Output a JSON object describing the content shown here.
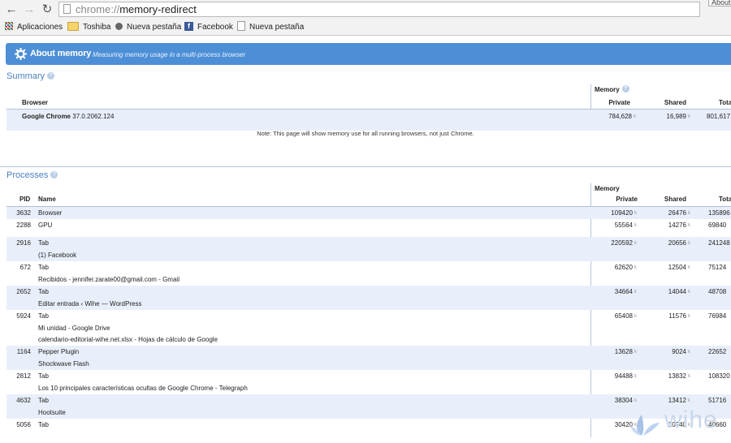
{
  "browser": {
    "url_scheme": "chrome://",
    "url_path": "memory-redirect",
    "about_tab": "About"
  },
  "bookmarks": [
    {
      "label": "Aplicaciones",
      "icon": "apps-icon"
    },
    {
      "label": "Toshiba",
      "icon": "folder-icon"
    },
    {
      "label": "Nueva pestaña",
      "icon": "circle-icon"
    },
    {
      "label": "Facebook",
      "icon": "facebook-icon"
    },
    {
      "label": "Nueva pestaña",
      "icon": "page-icon"
    }
  ],
  "header": {
    "title": "About memory",
    "subtitle": "Measuring memory usage in a multi-process browser"
  },
  "summary": {
    "title": "Summary",
    "col_browser": "Browser",
    "col_memory": "Memory",
    "col_private": "Private",
    "col_shared": "Shared",
    "col_total": "Total",
    "row": {
      "name": "Google Chrome",
      "version": "37.0.2062.124",
      "private": "784,628",
      "shared": "16,989",
      "total": "801,617"
    },
    "unit": "k",
    "note": "Note: This page will show memory use for all running browsers, not just Chrome."
  },
  "processes": {
    "title": "Processes",
    "col_pid": "PID",
    "col_name": "Name",
    "col_memory": "Memory",
    "col_private": "Private",
    "col_shared": "Shared",
    "col_total": "Total",
    "unit": "k",
    "rows": [
      {
        "pid": "3632",
        "type": "Browser",
        "lines": [],
        "private": "109420",
        "shared": "26476",
        "total": "135896"
      },
      {
        "pid": "2288",
        "type": "GPU",
        "lines": [],
        "private": "55564",
        "shared": "14276",
        "total": "69840"
      },
      {
        "pid": "2916",
        "type": "Tab",
        "lines": [
          "(1) Facebook"
        ],
        "private": "220592",
        "shared": "20656",
        "total": "241248"
      },
      {
        "pid": "672",
        "type": "Tab",
        "lines": [
          "Recibidos - jennifer.zarate00@gmail.com - Gmail"
        ],
        "private": "62620",
        "shared": "12504",
        "total": "75124"
      },
      {
        "pid": "2652",
        "type": "Tab",
        "lines": [
          "Editar entrada ‹ Wihe — WordPress"
        ],
        "private": "34664",
        "shared": "14044",
        "total": "48708"
      },
      {
        "pid": "5924",
        "type": "Tab",
        "lines": [
          "Mi unidad - Google Drive",
          "calendario-editorial-wihe.net.xlsx - Hojas de cálculo de Google"
        ],
        "private": "65408",
        "shared": "11576",
        "total": "76984"
      },
      {
        "pid": "1164",
        "type": "Pepper Plugin",
        "lines": [
          "Shockwave Flash"
        ],
        "private": "13628",
        "shared": "9024",
        "total": "22652"
      },
      {
        "pid": "2812",
        "type": "Tab",
        "lines": [
          "Los 10 principales características ocultas de Google Chrome - Telegraph"
        ],
        "private": "94488",
        "shared": "13832",
        "total": "108320"
      },
      {
        "pid": "4632",
        "type": "Tab",
        "lines": [
          "Hootsuite"
        ],
        "private": "38304",
        "shared": "13412",
        "total": "51716"
      },
      {
        "pid": "5056",
        "type": "Tab",
        "lines": [],
        "private": "30420",
        "shared": "10240",
        "total": "40660"
      }
    ]
  },
  "watermark": {
    "text": "wihe"
  },
  "colors": {
    "accent": "#4d8fd6",
    "row_alt": "#e9effa",
    "section_title": "#4a7fc1"
  }
}
